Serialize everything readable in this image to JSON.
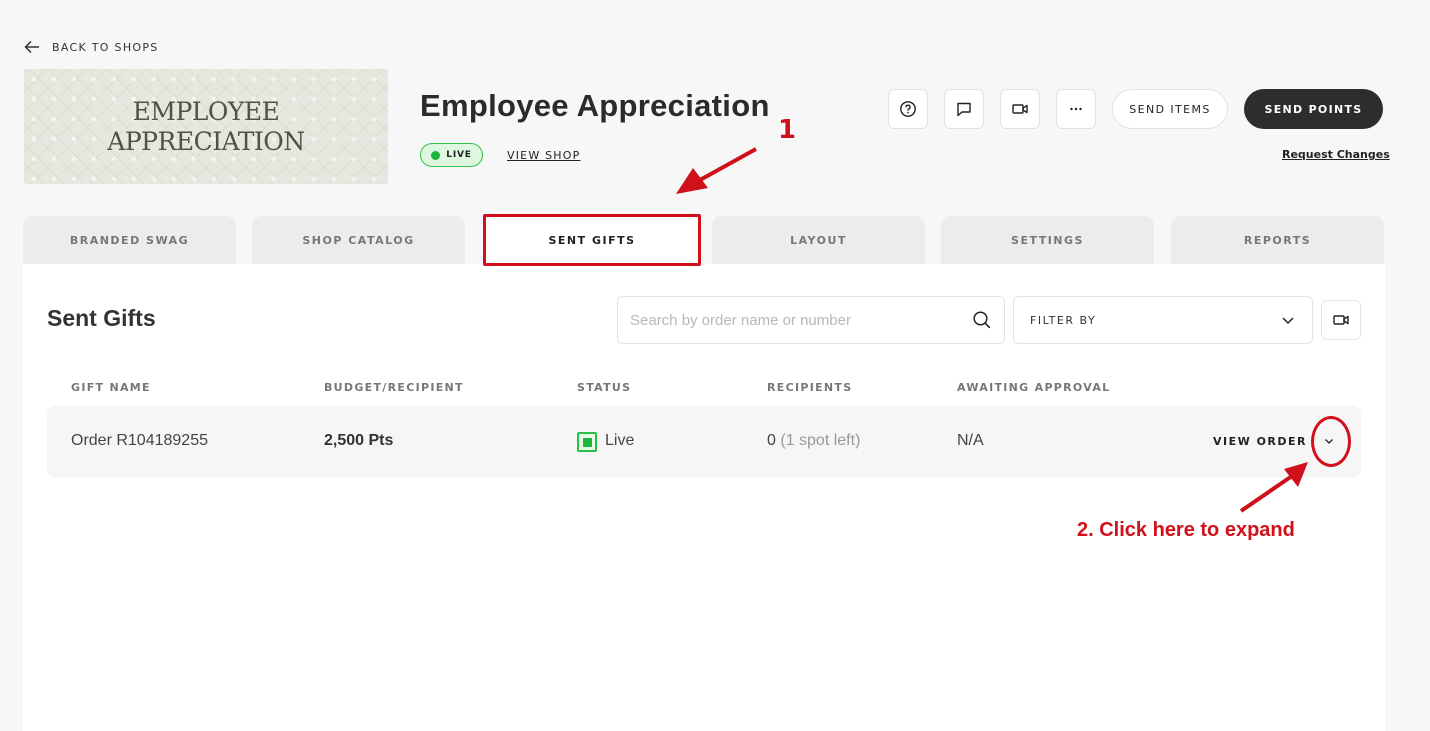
{
  "header": {
    "back_label": "BACK TO SHOPS",
    "banner_line1": "EMPLOYEE",
    "banner_line2": "APPRECIATION",
    "title": "Employee Appreciation",
    "status_pill": "LIVE",
    "view_shop": "VIEW SHOP",
    "send_items": "SEND ITEMS",
    "send_points": "SEND POINTS",
    "request_changes": "Request Changes"
  },
  "tabs": [
    "BRANDED SWAG",
    "SHOP CATALOG",
    "SENT GIFTS",
    "LAYOUT",
    "SETTINGS",
    "REPORTS"
  ],
  "active_tab": "SENT GIFTS",
  "main": {
    "section_title": "Sent Gifts",
    "search_placeholder": "Search by order name or number",
    "filter_label": "FILTER BY",
    "columns": [
      "GIFT NAME",
      "BUDGET/RECIPIENT",
      "STATUS",
      "RECIPIENTS",
      "AWAITING APPROVAL"
    ],
    "rows": [
      {
        "gift_name": "Order R104189255",
        "budget": "2,500 Pts",
        "status": "Live",
        "recipients": "0",
        "recipients_note": "(1 spot left)",
        "awaiting": "N/A",
        "action": "VIEW ORDER"
      }
    ]
  },
  "annotations": {
    "step1": "1",
    "step2": "2. Click here to expand"
  },
  "colors": {
    "accent_dark": "#2d2d2d",
    "live_green": "#1db33a",
    "annotation_red": "#d0101a"
  },
  "icons": [
    "arrow-left-icon",
    "help-icon",
    "chat-icon",
    "video-icon",
    "more-icon",
    "search-icon",
    "chevron-down-icon"
  ]
}
